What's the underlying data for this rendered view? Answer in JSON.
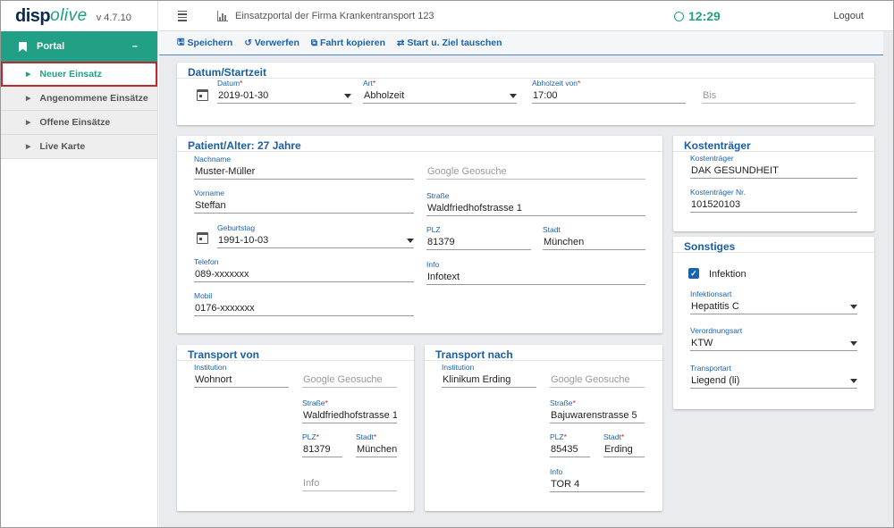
{
  "app": {
    "logo_a": "disp",
    "logo_b": "olive",
    "version": "v 4.7.10",
    "title": "Einsatzportal der Firma Krankentransport 123",
    "clock": "12:29",
    "logout": "Logout",
    "accent": "#22a085",
    "link_color": "#1a62ad"
  },
  "sidebar": {
    "portal_label": "Portal",
    "collapse": "–",
    "items": [
      {
        "label": "Neuer Einsatz"
      },
      {
        "label": "Angenommene Einsätze"
      },
      {
        "label": "Offene Einsätze"
      },
      {
        "label": "Live Karte"
      }
    ]
  },
  "toolbar": {
    "save": "Speichern",
    "discard": "Verwerfen",
    "copy": "Fahrt kopieren",
    "swap": "Start u. Ziel tauschen"
  },
  "datum": {
    "header": "Datum/Startzeit",
    "datum_label": "Datum",
    "datum_value": "2019-01-30",
    "art_label": "Art",
    "art_value": "Abholzeit",
    "abholzeit_label": "Abholzeit von",
    "abholzeit_value": "17:00",
    "bis_placeholder": "Bis"
  },
  "patient": {
    "header": "Patient/Alter: 27 Jahre",
    "nachname_label": "Nachname",
    "nachname_value": "Muster-Müller",
    "geosuche_placeholder": "Google Geosuche",
    "vorname_label": "Vorname",
    "vorname_value": "Steffan",
    "strasse_label": "Straße",
    "strasse_value": "Waldfriedhofstrasse 1",
    "geburtstag_label": "Geburtstag",
    "geburtstag_value": "1991-10-03",
    "plz_label": "PLZ",
    "plz_value": "81379",
    "stadt_label": "Stadt",
    "stadt_value": "München",
    "telefon_label": "Telefon",
    "telefon_value": "089-xxxxxxx",
    "info_label": "Info",
    "info_value": "Infotext",
    "mobil_label": "Mobil",
    "mobil_value": "0176-xxxxxxx"
  },
  "kosten": {
    "header": "Kostenträger",
    "traeger_label": "Kostenträger",
    "traeger_value": "DAK GESUNDHEIT",
    "nr_label": "Kostenträger Nr.",
    "nr_value": "101520103"
  },
  "sonstiges": {
    "header": "Sonstiges",
    "infektion_label": "Infektion",
    "infektion_checked": true,
    "infektionsart_label": "Infektionsart",
    "infektionsart_value": "Hepatitis C",
    "verordnungsart_label": "Verordnungsart",
    "verordnungsart_value": "KTW",
    "transportart_label": "Transportart",
    "transportart_value": "Liegend (li)"
  },
  "von": {
    "header": "Transport von",
    "institution_label": "Institution",
    "institution_value": "Wohnort",
    "geosuche_placeholder": "Google Geosuche",
    "strasse_label": "Straße",
    "strasse_value": "Waldfriedhofstrasse 1",
    "plz_label": "PLZ",
    "plz_value": "81379",
    "stadt_label": "Stadt",
    "stadt_value": "München",
    "info_placeholder": "Info"
  },
  "nach": {
    "header": "Transport nach",
    "institution_label": "Institution",
    "institution_value": "Klinikum Erding",
    "geosuche_placeholder": "Google Geosuche",
    "strasse_label": "Straße",
    "strasse_value": "Bajuwarenstrasse 5",
    "plz_label": "PLZ",
    "plz_value": "85435",
    "stadt_label": "Stadt",
    "stadt_value": "Erding",
    "info_label": "Info",
    "info_value": "TOR 4"
  }
}
